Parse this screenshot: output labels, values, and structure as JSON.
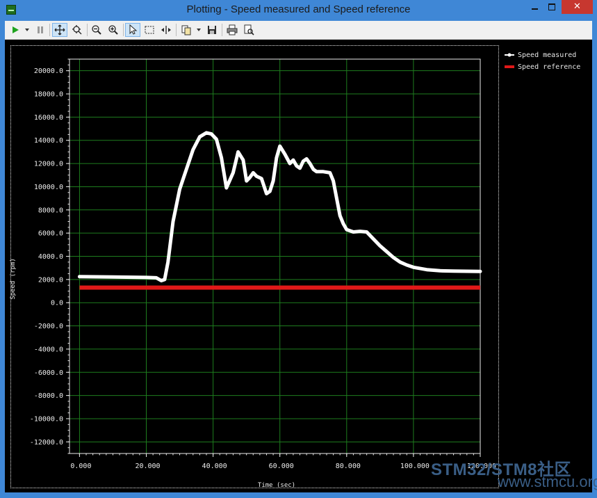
{
  "window": {
    "title": "Plotting  - Speed measured and Speed reference",
    "close_label": "✕"
  },
  "toolbar": {
    "buttons": [
      {
        "name": "play-icon"
      },
      {
        "name": "pause-icon"
      },
      {
        "name": "pan-icon",
        "active": true
      },
      {
        "name": "zoom-fit-icon"
      },
      {
        "name": "zoom-out-icon"
      },
      {
        "name": "zoom-in-icon"
      },
      {
        "name": "select-pointer-icon",
        "active": true
      },
      {
        "name": "rectangle-select-icon"
      },
      {
        "name": "split-icon"
      },
      {
        "name": "copy-icon"
      },
      {
        "name": "save-icon"
      },
      {
        "name": "print-icon"
      },
      {
        "name": "print-preview-icon"
      }
    ]
  },
  "colors": {
    "plot_background": "#000000",
    "grid": "#1e7d1e",
    "axis_text": "#ededed",
    "speed_measured": "#ffffff",
    "speed_reference": "#e01818",
    "watermark": "#3a5e86"
  },
  "chart_data": {
    "type": "line",
    "title": "",
    "xlabel": "Time (sec)",
    "ylabel": "Speed (rpm)",
    "xlim": [
      -3,
      120
    ],
    "ylim": [
      -13000,
      21000
    ],
    "grid": true,
    "legend_position": "right",
    "x_ticks": [
      "0.000",
      "20.000",
      "40.000",
      "60.000",
      "80.000",
      "100.000",
      "120.000"
    ],
    "x_tick_values": [
      0,
      20,
      40,
      60,
      80,
      100,
      120
    ],
    "y_ticks": [
      "20000.0",
      "18000.0",
      "16000.0",
      "14000.0",
      "12000.0",
      "10000.0",
      "8000.0",
      "6000.0",
      "4000.0",
      "2000.0",
      "0.0",
      "-2000.0",
      "-4000.0",
      "-6000.0",
      "-8000.0",
      "-10000.0",
      "-12000.0"
    ],
    "y_tick_values": [
      20000,
      18000,
      16000,
      14000,
      12000,
      10000,
      8000,
      6000,
      4000,
      2000,
      0,
      -2000,
      -4000,
      -6000,
      -8000,
      -10000,
      -12000
    ],
    "series": [
      {
        "name": "Speed measured",
        "color": "#ffffff",
        "x": [
          0,
          10,
          20,
          23,
          24.5,
          25.5,
          26.5,
          28,
          30,
          32,
          34,
          36,
          38,
          39.5,
          41,
          42.5,
          44,
          46,
          47.5,
          49,
          50,
          51,
          52,
          53,
          54.5,
          56,
          57,
          58,
          59,
          60,
          61.5,
          63,
          64,
          65,
          66,
          67,
          68,
          69,
          70,
          71,
          73,
          75,
          76,
          77,
          78,
          79,
          80,
          82,
          84,
          86,
          88,
          90,
          92,
          94,
          96,
          98,
          100,
          104,
          108,
          112,
          116,
          120
        ],
        "y": [
          2250,
          2220,
          2180,
          2150,
          1900,
          2000,
          3500,
          7000,
          9800,
          11500,
          13200,
          14300,
          14650,
          14550,
          14100,
          12500,
          9900,
          11200,
          13000,
          12300,
          10500,
          10800,
          11200,
          10900,
          10700,
          9400,
          9600,
          10500,
          12500,
          13500,
          12800,
          12000,
          12300,
          11800,
          11600,
          12200,
          12400,
          12000,
          11500,
          11300,
          11300,
          11200,
          10500,
          9000,
          7500,
          6800,
          6300,
          6100,
          6150,
          6100,
          5500,
          4900,
          4400,
          3900,
          3500,
          3250,
          3050,
          2850,
          2750,
          2720,
          2710,
          2700
        ]
      },
      {
        "name": "Speed reference",
        "color": "#e01818",
        "x": [
          0,
          120
        ],
        "y": [
          1300,
          1300
        ]
      }
    ]
  },
  "watermark": {
    "line1": "STM32/STM8社区",
    "line2": "www.stmcu.org"
  }
}
